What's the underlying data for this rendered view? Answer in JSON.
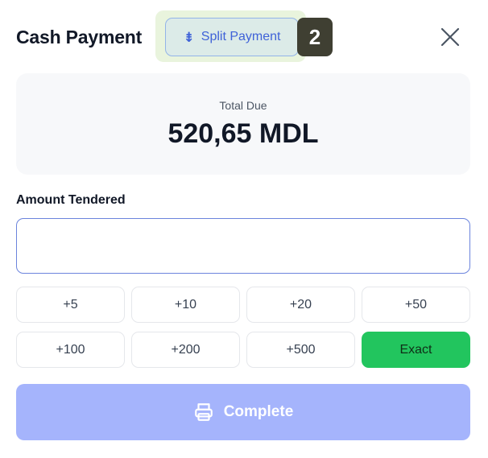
{
  "header": {
    "title": "Cash Payment",
    "split_button_label": "Split Payment",
    "split_icon_glyph": "⇟",
    "badge_number": "2",
    "close_icon": "close-icon"
  },
  "total": {
    "label": "Total Due",
    "value": "520,65 MDL"
  },
  "amount": {
    "label": "Amount Tendered",
    "value": "",
    "placeholder": ""
  },
  "quick_amounts": [
    {
      "label": "+5"
    },
    {
      "label": "+10"
    },
    {
      "label": "+20"
    },
    {
      "label": "+50"
    },
    {
      "label": "+100"
    },
    {
      "label": "+200"
    },
    {
      "label": "+500"
    },
    {
      "label": "Exact"
    }
  ],
  "complete": {
    "label": "Complete",
    "icon": "printer-icon"
  },
  "colors": {
    "accent": "#3f62d8",
    "exact_green": "#22c55e",
    "complete_disabled": "#a5b4fc",
    "split_highlight": "#e9f4dd"
  }
}
